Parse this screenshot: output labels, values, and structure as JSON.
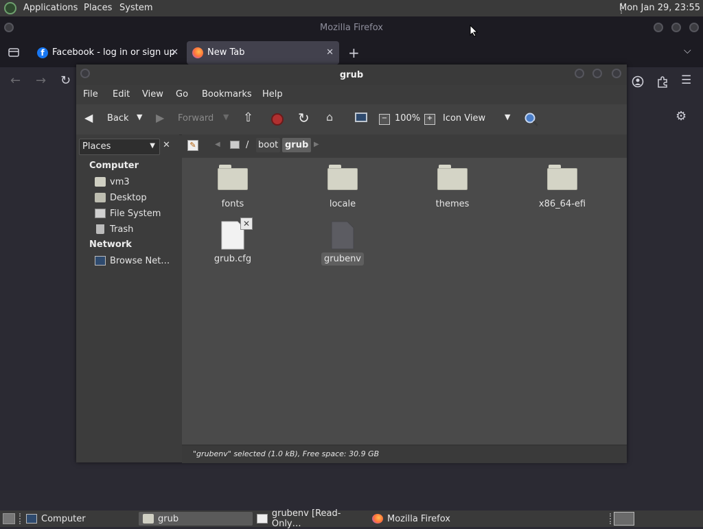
{
  "top_panel": {
    "menus": [
      "Applications",
      "Places",
      "System"
    ],
    "clock": "Mon Jan 29, 23:55"
  },
  "firefox": {
    "title": "Mozilla Firefox",
    "tabs": [
      {
        "label": "Facebook - log in or sign up",
        "icon": "facebook-icon"
      },
      {
        "label": "New Tab",
        "icon": "firefox-icon"
      }
    ]
  },
  "caja": {
    "title": "grub",
    "menu": [
      "File",
      "Edit",
      "View",
      "Go",
      "Bookmarks",
      "Help"
    ],
    "toolbar": {
      "back": "Back",
      "forward": "Forward",
      "zoom": "100%",
      "view_mode": "Icon View"
    },
    "sidebar": {
      "combo": "Places",
      "sections": [
        {
          "header": "Computer",
          "items": [
            "vm3",
            "Desktop",
            "File System",
            "Trash"
          ]
        },
        {
          "header": "Network",
          "items": [
            "Browse Net…"
          ]
        }
      ]
    },
    "path": [
      "/",
      "boot",
      "grub"
    ],
    "files": [
      {
        "name": "fonts",
        "type": "folder"
      },
      {
        "name": "locale",
        "type": "folder"
      },
      {
        "name": "themes",
        "type": "folder"
      },
      {
        "name": "x86_64-efi",
        "type": "folder"
      },
      {
        "name": "grub.cfg",
        "type": "file"
      },
      {
        "name": "grubenv",
        "type": "file-selected"
      }
    ],
    "status": "\"grubenv\" selected (1.0 kB), Free space: 30.9 GB"
  },
  "taskbar": {
    "items": [
      "Computer",
      "grub",
      "grubenv [Read-Only…",
      "Mozilla Firefox"
    ]
  },
  "colors": {
    "panel": "#3a3a3a",
    "firefox_bg": "#1c1b22",
    "content_bg": "#4a4a4a"
  }
}
